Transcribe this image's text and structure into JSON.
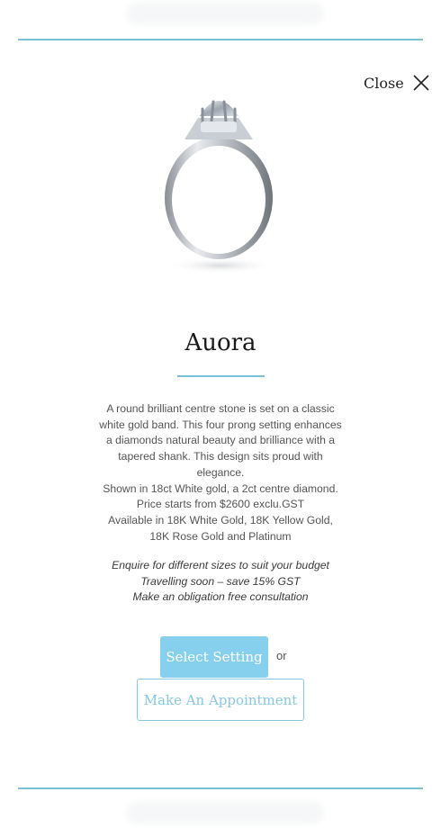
{
  "close": {
    "label": "Close",
    "icon": "close-icon"
  },
  "product": {
    "image": "solitaire-ring-image",
    "title": "Auora",
    "description": [
      "A round brilliant centre stone is set on a classic white gold band. This four prong setting enhances a diamonds natural beauty and brilliance with a tapered shank. This design sits proud with elegance.",
      "Shown in 18ct White gold, a 2ct centre diamond.",
      "Price starts from $2600 exclu.GST",
      "Available in 18K White Gold, 18K Yellow Gold, 18K Rose Gold and Platinum"
    ],
    "promo": [
      "Enquire for different sizes to suit your budget",
      "Travelling soon – save 15% GST",
      "Make an obligation free consultation"
    ]
  },
  "actions": {
    "select_setting": "Select Setting",
    "or": "or",
    "appointment": "Make An Appointment"
  },
  "colors": {
    "accent": "#7dbfd6",
    "button_fill": "#86d0ee"
  }
}
